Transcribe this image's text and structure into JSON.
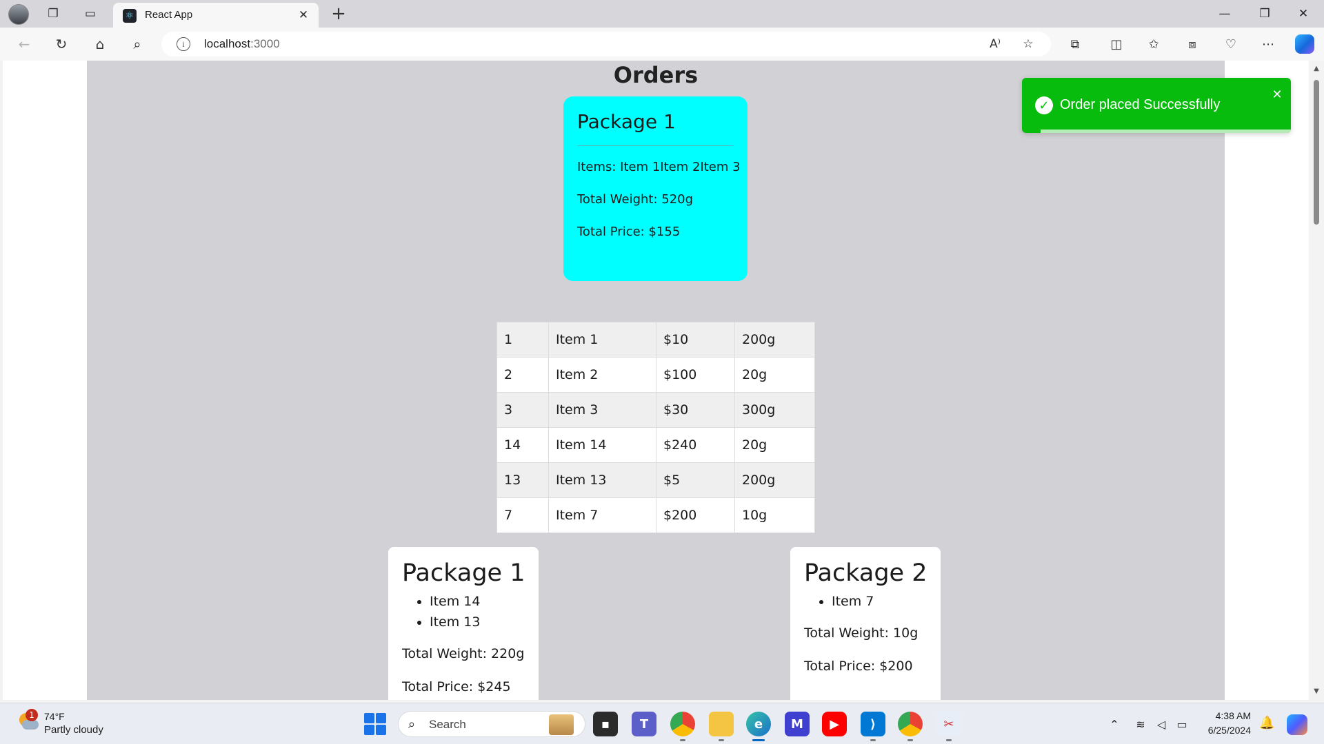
{
  "browser": {
    "tab_title": "React App",
    "address_host": "localhost",
    "address_port": ":3000",
    "icons": {
      "profile": "profile-avatar",
      "workspaces": "workspaces-icon",
      "tab_actions": "tab-actions-icon",
      "favicon": "react-logo-icon",
      "tab_close": "close-icon",
      "new_tab": "plus-icon",
      "back": "back-arrow-icon",
      "refresh": "refresh-icon",
      "home": "home-icon",
      "search": "search-icon",
      "site_info": "info-icon",
      "read_aloud": "read-aloud-icon",
      "favorite": "star-icon",
      "extensions": "puzzle-icon",
      "split_screen": "split-screen-icon",
      "favorites": "favorites-icon",
      "collections": "collections-icon",
      "browser_essentials": "heart-pulse-icon",
      "more": "more-icon",
      "copilot": "copilot-icon"
    }
  },
  "page": {
    "title": "Orders",
    "summary_card": {
      "title": "Package 1",
      "items_line": "Items: Item 1Item 2Item 3",
      "weight_line": "Total Weight: 520g",
      "price_line": "Total Price: $155"
    },
    "table_rows": [
      {
        "id": "1",
        "name": "Item 1",
        "price": "$10",
        "weight": "200g"
      },
      {
        "id": "2",
        "name": "Item 2",
        "price": "$100",
        "weight": "20g"
      },
      {
        "id": "3",
        "name": "Item 3",
        "price": "$30",
        "weight": "300g"
      },
      {
        "id": "14",
        "name": "Item 14",
        "price": "$240",
        "weight": "20g"
      },
      {
        "id": "13",
        "name": "Item 13",
        "price": "$5",
        "weight": "200g"
      },
      {
        "id": "7",
        "name": "Item 7",
        "price": "$200",
        "weight": "10g"
      }
    ],
    "packages": [
      {
        "title": "Package 1",
        "items": [
          "Item 14",
          "Item 13"
        ],
        "weight_line": "Total Weight: 220g",
        "price_line": "Total Price: $245"
      },
      {
        "title": "Package 2",
        "items": [
          "Item 7"
        ],
        "weight_line": "Total Weight: 10g",
        "price_line": "Total Price: $200"
      }
    ],
    "toast": {
      "message": "Order placed Successfully",
      "type": "success",
      "color": "#07bc0c",
      "progress_remaining": 0.93
    }
  },
  "taskbar": {
    "weather_temp": "74°F",
    "weather_condition": "Partly cloudy",
    "weather_badge": "1",
    "search_placeholder": "Search",
    "clock_time": "4:38 AM",
    "clock_date": "6/25/2024",
    "apps": [
      "file-explorer-icon",
      "teams-icon",
      "chrome-icon",
      "folder-icon",
      "edge-icon",
      "mathway-icon",
      "youtube-icon",
      "vscode-icon",
      "chrome-profile-icon",
      "snipping-tool-icon"
    ],
    "tray": [
      "chevron-up-icon",
      "wifi-icon",
      "volume-icon",
      "battery-icon",
      "bell-icon"
    ]
  },
  "colors": {
    "summary_card": "#00ffff",
    "page_background": "#d2d2d6",
    "toast_success": "#07bc0c"
  }
}
